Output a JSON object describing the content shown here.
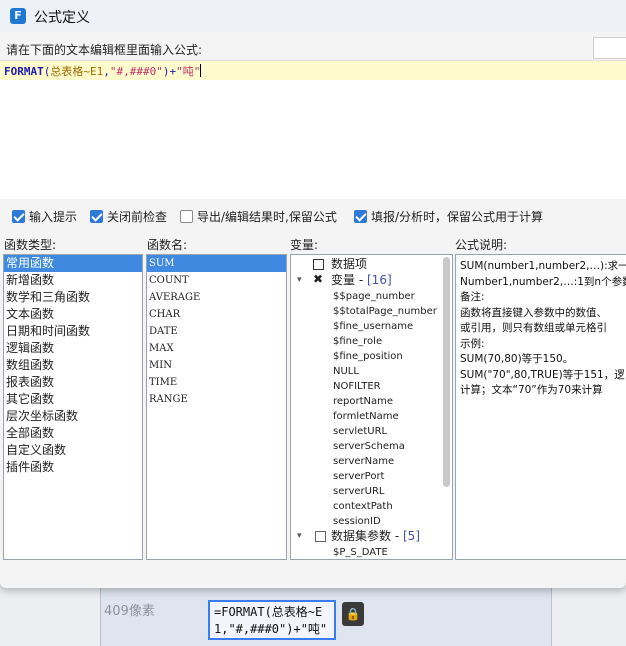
{
  "window": {
    "title": "公式定义",
    "app_icon": "F"
  },
  "editor": {
    "prompt": "请在下面的文本编辑框里面输入公式:",
    "formula_parts": {
      "fn": "FORMAT",
      "open": "(",
      "ref": "总表格~E1",
      "sep1": ",",
      "pattern": "\"#,###0\"",
      "close": ")+",
      "unit": "\"吨\""
    }
  },
  "options": [
    {
      "label": "输入提示",
      "checked": true
    },
    {
      "label": "关闭前检查",
      "checked": true
    },
    {
      "label": "导出/编辑结果时,保留公式",
      "checked": false
    },
    {
      "label": "填报/分析时，保留公式用于计算",
      "checked": true
    }
  ],
  "function_types": {
    "label": "函数类型:",
    "items": [
      "常用函数",
      "新增函数",
      "数学和三角函数",
      "文本函数",
      "日期和时间函数",
      "逻辑函数",
      "数组函数",
      "报表函数",
      "其它函数",
      "层次坐标函数",
      "全部函数",
      "自定义函数",
      "插件函数"
    ],
    "selected_index": 0
  },
  "function_names": {
    "label": "函数名:",
    "items": [
      "SUM",
      "COUNT",
      "AVERAGE",
      "CHAR",
      "DATE",
      "MAX",
      "MIN",
      "TIME",
      "RANGE"
    ],
    "selected_index": 0
  },
  "variables": {
    "label": "变量:",
    "data_item": "数据项",
    "var_group": {
      "label": "变量",
      "count": "[16]"
    },
    "var_items": [
      "$$page_number",
      "$$totalPage_number",
      "$fine_username",
      "$fine_role",
      "$fine_position",
      "NULL",
      "NOFILTER",
      "reportName",
      "formletName",
      "servletURL",
      "serverSchema",
      "serverName",
      "serverPort",
      "serverURL",
      "contextPath",
      "sessionID"
    ],
    "dataset_group": {
      "label": "数据集参数",
      "count": "[5]"
    },
    "dataset_items": [
      "$P_S_DATE"
    ]
  },
  "description": {
    "label": "公式说明:",
    "lines": [
      "SUM(number1,number2,…):求一",
      "Number1,number2,…:1到n个参数",
      "备注:",
      "函数将直接键入参数中的数值、",
      "或引用，则只有数组或单元格引",
      "示例:",
      "SUM(70,80)等于150。",
      "SUM(\"70\",80,TRUE)等于151，逻",
      "计算；文本“70”作为70来计算"
    ]
  },
  "background": {
    "row_height_label": "409像素",
    "cell_text_line1": "=FORMAT(总表格~E",
    "cell_text_line2": "1,\"#,###0\")+\"吨\""
  }
}
